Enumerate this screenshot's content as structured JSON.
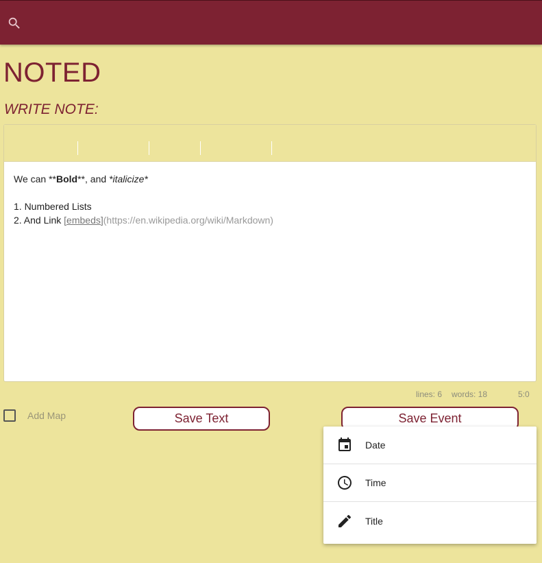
{
  "header": {
    "search_icon": "search-icon",
    "background_color": "#7d2232"
  },
  "app": {
    "title": "NOTED",
    "write_label": "WRITE NOTE:"
  },
  "editor": {
    "line1": {
      "pre": "We can **",
      "bold": "Bold",
      "mid": "**, and ",
      "italic": "*italicize*"
    },
    "line3": "1. Numbered Lists",
    "line4": {
      "pre": "2. And Link ",
      "link": "[embeds]",
      "url": "(https://en.wikipedia.org/wiki/Markdown)"
    }
  },
  "status": {
    "lines": "lines: 6",
    "words": "words: 18",
    "cursor": "5:0"
  },
  "controls": {
    "add_map_label": "Add Map",
    "add_map_checked": false,
    "save_text_label": "Save Text",
    "save_event_label": "Save Event"
  },
  "event_menu": {
    "items": [
      {
        "label": "Date",
        "icon": "calendar-icon"
      },
      {
        "label": "Time",
        "icon": "clock-icon"
      },
      {
        "label": "Title",
        "icon": "pencil-icon"
      }
    ]
  },
  "colors": {
    "accent": "#7d2232",
    "background": "#ede49c"
  }
}
